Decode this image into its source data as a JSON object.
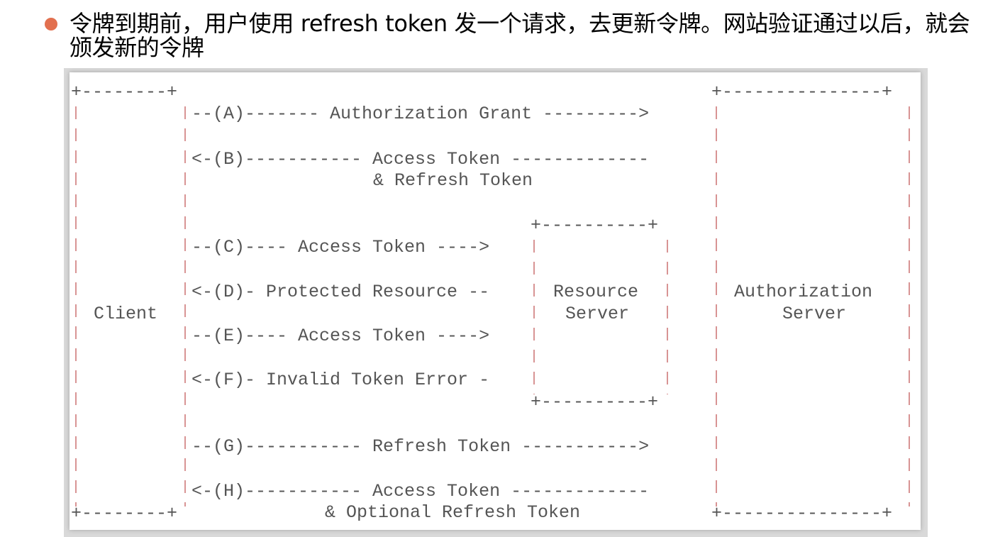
{
  "bullet": {
    "text": "令牌到期前，用户使用 refresh token 发一个请求，去更新令牌。网站验证通过以后，就会颁发新的令牌",
    "dot_color": "#e2704f"
  },
  "diagram": {
    "text_color": "#555555",
    "border_color": "#c25b5b",
    "border_line_top": "+--------+                                    +---------------+",
    "border_line_bottom_left": "+--------+",
    "border_line_bottom_right": "+---------------+",
    "resource_box_top": "+----------+",
    "resource_box_bottom": "+----------+",
    "arrows": {
      "a": "--(A)------- Authorization Grant --------->",
      "b": "<-(B)----------- Access Token -------------",
      "b2": "& Refresh Token",
      "c": "--(C)---- Access Token ---->",
      "d": "<-(D)- Protected Resource --",
      "e": "--(E)---- Access Token ---->",
      "f": "<-(F)- Invalid Token Error -",
      "g": "--(G)----------- Refresh Token ----------->",
      "h": "<-(H)----------- Access Token -------------",
      "h2": "& Optional Refresh Token"
    },
    "client_label": "Client",
    "resource_server_label_1": "Resource",
    "resource_server_label_2": "Server",
    "auth_server_label_1": "Authorization",
    "auth_server_label_2": "Server"
  }
}
